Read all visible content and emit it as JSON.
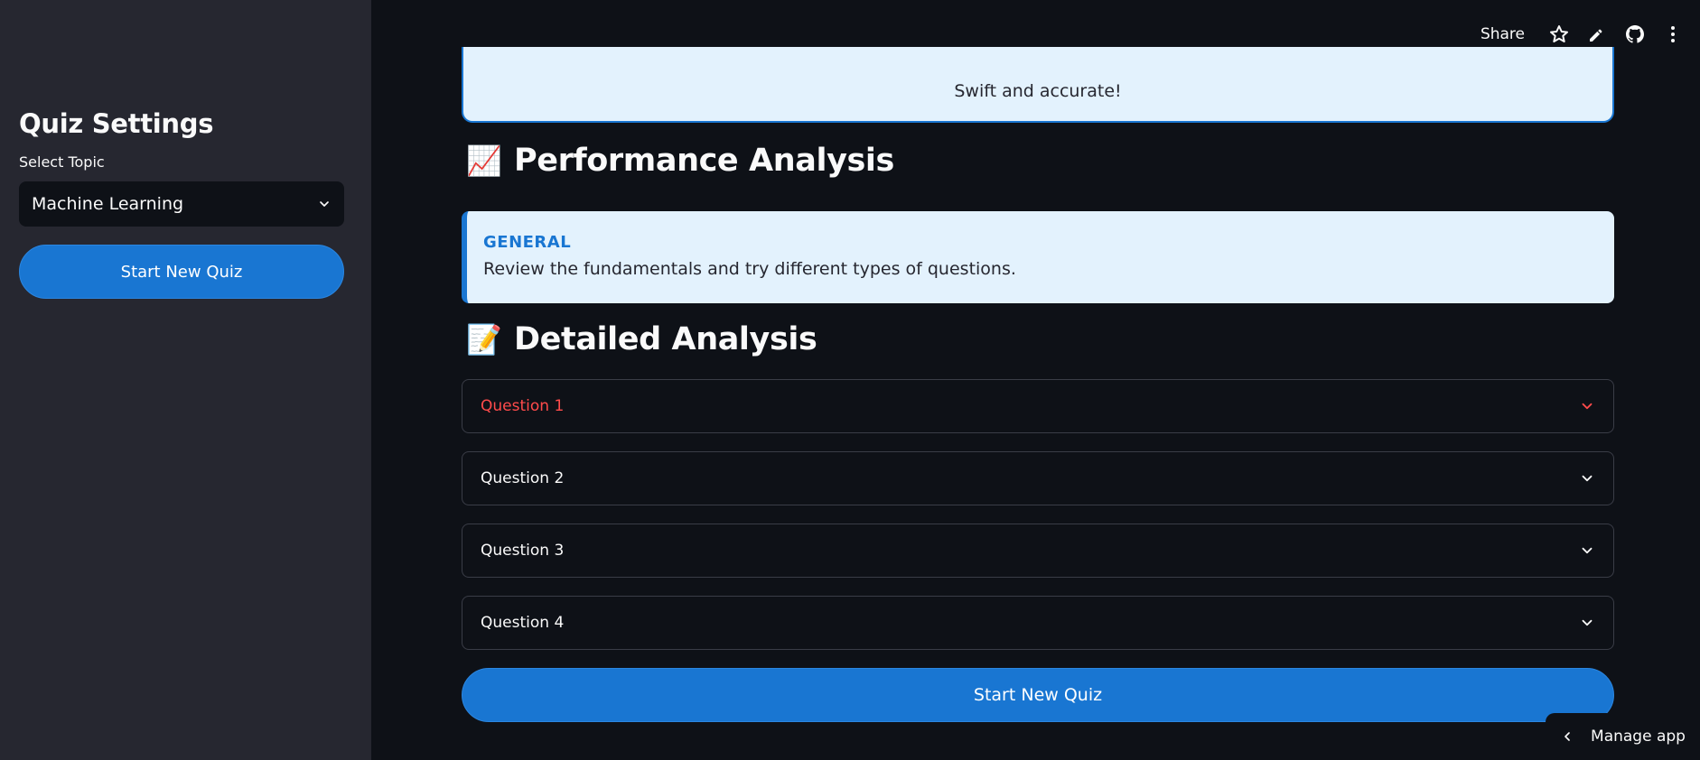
{
  "sidebar": {
    "title": "Quiz Settings",
    "topic_label": "Select Topic",
    "topic_value": "Machine Learning",
    "start_button": "Start New Quiz"
  },
  "toolbar": {
    "share_label": "Share",
    "icons": [
      "star-icon",
      "pencil-icon",
      "github-icon",
      "more-vertical-icon"
    ]
  },
  "main": {
    "banner_text": "Swift and accurate!",
    "performance": {
      "emoji": "📈",
      "title": "Performance Analysis",
      "category": "GENERAL",
      "message": "Review the fundamentals and try different types of questions."
    },
    "detailed": {
      "emoji": "📝",
      "title": "Detailed Analysis",
      "questions": [
        {
          "label": "Question 1",
          "color": "#ff4b4b"
        },
        {
          "label": "Question 2",
          "color": "#fafafa"
        },
        {
          "label": "Question 3",
          "color": "#fafafa"
        },
        {
          "label": "Question 4",
          "color": "#fafafa"
        }
      ]
    },
    "start_button": "Start New Quiz"
  },
  "footer": {
    "manage_label": "Manage app"
  },
  "colors": {
    "accent": "#1976d2",
    "background": "#0e1117",
    "sidebar": "#262730",
    "info_bg": "#e3f2fd",
    "error": "#ff4b4b"
  }
}
